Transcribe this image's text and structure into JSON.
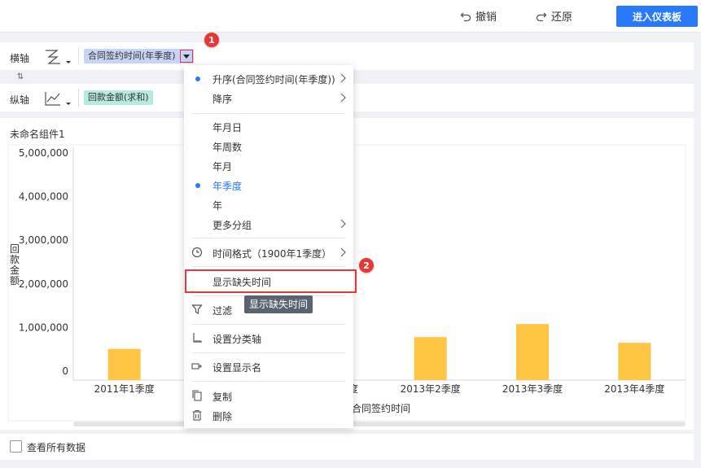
{
  "toolbar": {
    "undo_label": "撤销",
    "redo_label": "还原",
    "enter_dashboard_label": "进入仪表板"
  },
  "x_axis_row": {
    "label": "横轴",
    "field": "合同签约时间(年季度)"
  },
  "y_axis_row": {
    "label": "纵轴",
    "field": "回款金额(求和)"
  },
  "swap_label": "⇅",
  "widget": {
    "title": "未命名组件1"
  },
  "menu": {
    "items": [
      {
        "label": "升序(合同签约时间(年季度))",
        "dot": true,
        "arrow": true,
        "selected": false
      },
      {
        "label": "降序",
        "dot": false,
        "arrow": true,
        "selected": false
      },
      {
        "label": "年月日",
        "dot": false,
        "arrow": false,
        "selected": false
      },
      {
        "label": "年周数",
        "dot": false,
        "arrow": false,
        "selected": false
      },
      {
        "label": "年月",
        "dot": false,
        "arrow": false,
        "selected": false
      },
      {
        "label": "年季度",
        "dot": true,
        "arrow": false,
        "selected": true
      },
      {
        "label": "年",
        "dot": false,
        "arrow": false,
        "selected": false
      },
      {
        "label": "更多分组",
        "dot": false,
        "arrow": true,
        "selected": false
      },
      {
        "label": "时间格式（1900年1季度）",
        "icon": "clock-icon",
        "arrow": true
      },
      {
        "label": "显示缺失时间"
      },
      {
        "label": "过滤",
        "icon": "filter-icon"
      },
      {
        "label": "设置分类轴",
        "icon": "axis-icon"
      },
      {
        "label": "设置显示名",
        "icon": "rename-icon"
      },
      {
        "label": "复制",
        "icon": "copy-icon"
      },
      {
        "label": "删除",
        "icon": "trash-icon"
      }
    ]
  },
  "tooltip": "显示缺失时间",
  "badges": [
    "1",
    "2"
  ],
  "footer": {
    "show_all_label": "查看所有数据"
  },
  "colors": {
    "primary": "#2979ff",
    "bar": "#ffc646",
    "highlight": "#e53935"
  },
  "chart_data": {
    "type": "bar",
    "categories": [
      "2011年1季度",
      "",
      "",
      "2013年2季度",
      "2013年3季度",
      "2013年4季度"
    ],
    "visible_partial_label": "度",
    "values": [
      510000,
      null,
      null,
      780000,
      1080000,
      650000
    ],
    "xlabel": "合同签约时间",
    "ylabel": "回款金额",
    "ylim": [
      0,
      5000000
    ],
    "yticks": [
      0,
      1000000,
      2000000,
      3000000,
      4000000,
      5000000
    ],
    "ytick_labels": [
      "0",
      "1,000,000",
      "2,000,000",
      "3,000,000",
      "4,000,000",
      "5,000,000"
    ],
    "grid": false
  }
}
